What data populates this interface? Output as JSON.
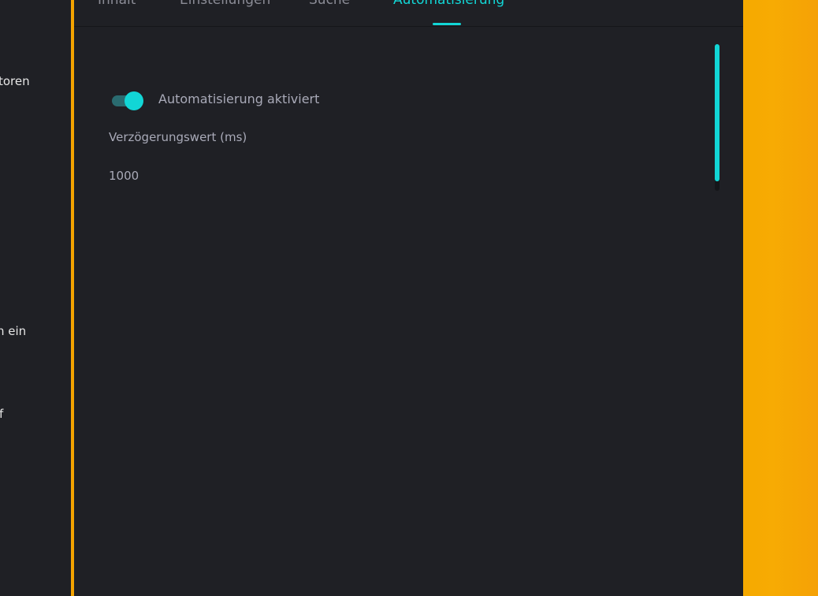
{
  "sidebar": {
    "fragments": [
      "toren",
      "n ein",
      "f"
    ]
  },
  "tabs": [
    {
      "label": "Inhalt",
      "active": false
    },
    {
      "label": "Einstellungen",
      "active": false
    },
    {
      "label": "Suche",
      "active": false
    },
    {
      "label": "Automatisierung",
      "active": true
    }
  ],
  "automation": {
    "toggle_label": "Automatisierung aktiviert",
    "toggle_on": true,
    "delay_label": "Verzögerungswert (ms)",
    "delay_value": "1000"
  },
  "colors": {
    "accent": "#12d6d6",
    "brand_orange": "#f4a300",
    "background": "#1f2025",
    "muted_text": "#a9aab8"
  }
}
